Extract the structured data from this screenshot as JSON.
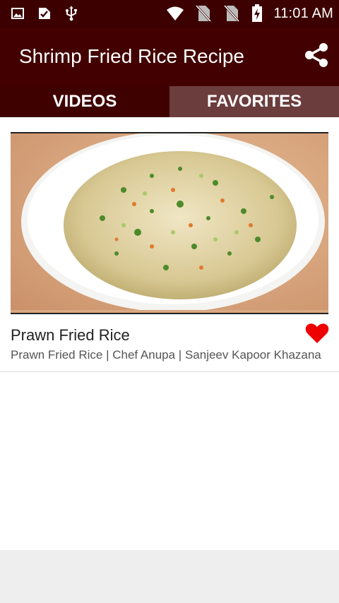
{
  "status_bar": {
    "time": "11:01 AM",
    "icons": [
      "image-icon",
      "download-check-icon",
      "usb-icon",
      "wifi-icon",
      "no-sim-icon",
      "no-sim-icon",
      "battery-charging-icon"
    ]
  },
  "app_bar": {
    "title": "Shrimp Fried Rice Recipe",
    "share_icon": "share-icon"
  },
  "tabs": [
    {
      "label": "VIDEOS",
      "active": true
    },
    {
      "label": "FAVORITES",
      "active": false
    }
  ],
  "videos": [
    {
      "title": "Prawn Fried Rice",
      "subtitle": "Prawn Fried Rice | Chef Anupa | Sanjeev Kapoor Khazana",
      "favorite": true,
      "favorite_icon": "heart-icon"
    }
  ],
  "colors": {
    "status_bar": "#3d0000",
    "app_bar": "#430000",
    "tab_active": "#3f0000",
    "tab_inactive": "#6b3d3d",
    "heart": "#ee0000"
  }
}
